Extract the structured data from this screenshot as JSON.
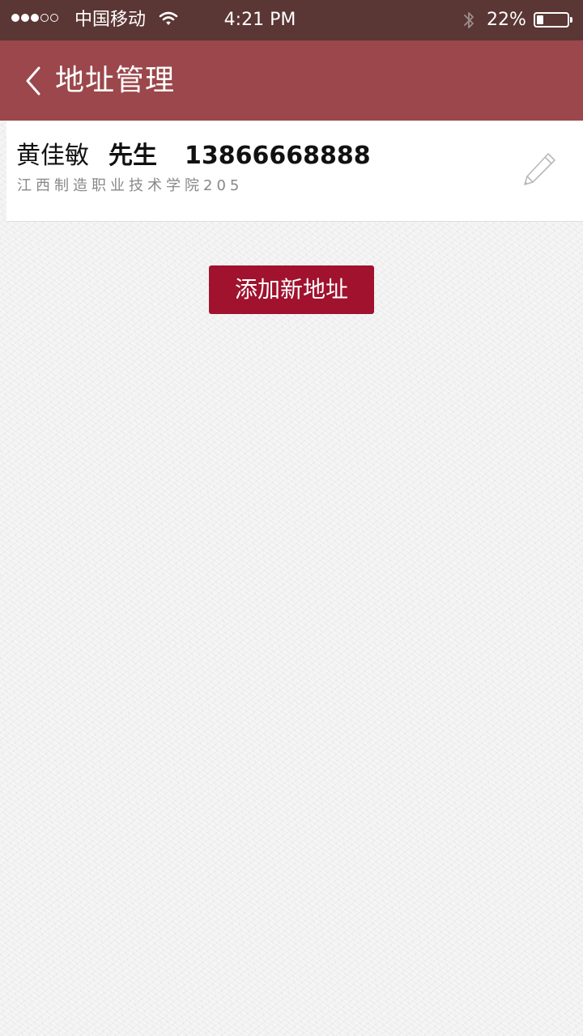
{
  "status_bar": {
    "signal_filled": 3,
    "signal_total": 5,
    "carrier": "中国移动",
    "time": "4:21 PM",
    "battery_percent_label": "22%",
    "battery_level": 0.22,
    "icons": [
      "wifi-icon",
      "bluetooth-icon",
      "battery-icon"
    ]
  },
  "nav": {
    "back_icon": "chevron-left-icon",
    "title": "地址管理"
  },
  "addresses": [
    {
      "name": "黄佳敏",
      "title": "先生",
      "phone": "13866668888",
      "address": "江西制造职业技术学院205",
      "edit_icon": "pencil-icon"
    }
  ],
  "actions": {
    "add_address_label": "添加新地址"
  },
  "colors": {
    "status_bar_bg": "#5a3634",
    "nav_bar_bg": "#9b474b",
    "accent_button": "#a0122e",
    "page_bg": "#f2f2f2"
  }
}
